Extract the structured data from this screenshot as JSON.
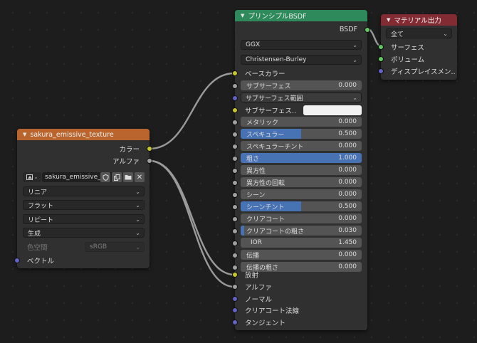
{
  "texture_node": {
    "title": "sakura_emissive_texture",
    "header_color": "#b9652d",
    "outputs": [
      "カラー",
      "アルファ"
    ],
    "image_name": "sakura_emissive_...",
    "interpolation": "リニア",
    "projection": "フラット",
    "extension": "リピート",
    "source": "生成",
    "colorspace_label": "色空間",
    "colorspace_value": "sRGB",
    "vector_input": "ベクトル"
  },
  "bsdf_node": {
    "title": "プリンシプルBSDF",
    "header_color": "#2f8a5b",
    "output": "BSDF",
    "distribution": "GGX",
    "subsurface_method": "Christensen-Burley",
    "base_color_label": "ベースカラー",
    "subsurface": {
      "label": "サブサーフェス",
      "value": "0.000"
    },
    "subsurface_radius": "サブサーフェス範囲",
    "subsurface_color": "サブサーフェス..",
    "metallic": {
      "label": "メタリック",
      "value": "0.000"
    },
    "specular": {
      "label": "スペキュラー",
      "value": "0.500",
      "fill": 0.5
    },
    "specular_tint": {
      "label": "スペキュラーチント",
      "value": "0.000"
    },
    "roughness": {
      "label": "粗さ",
      "value": "1.000",
      "fill": 1.0
    },
    "anisotropic": {
      "label": "異方性",
      "value": "0.000"
    },
    "anisotropic_rotation": {
      "label": "異方性の回転",
      "value": "0.000"
    },
    "sheen": {
      "label": "シーン",
      "value": "0.000"
    },
    "sheen_tint": {
      "label": "シーンチント",
      "value": "0.500",
      "fill": 0.5
    },
    "clearcoat": {
      "label": "クリアコート",
      "value": "0.000"
    },
    "clearcoat_roughness": {
      "label": "クリアコートの粗さ",
      "value": "0.030",
      "fill": 0.03
    },
    "ior": {
      "label": "IOR",
      "value": "1.450"
    },
    "transmission": {
      "label": "伝播",
      "value": "0.000"
    },
    "transmission_roughness": {
      "label": "伝播の粗さ",
      "value": "0.000"
    },
    "emission": "放射",
    "alpha": "アルファ",
    "normal": "ノーマル",
    "clearcoat_normal": "クリアコート法線",
    "tangent": "タンジェント"
  },
  "output_node": {
    "title": "マテリアル出力",
    "header_color": "#832b33",
    "target": "全て",
    "surface": "サーフェス",
    "volume": "ボリューム",
    "displacement": "ディスプレイスメン.."
  }
}
